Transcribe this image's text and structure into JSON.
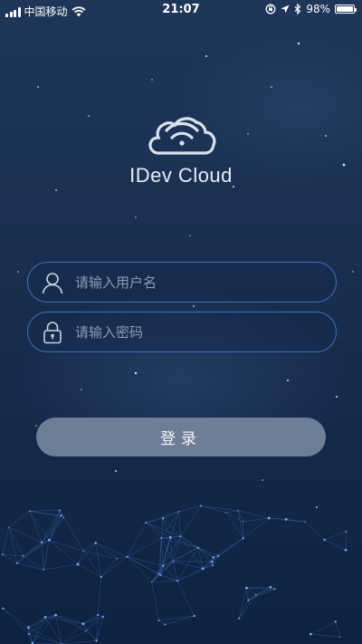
{
  "status_bar": {
    "carrier": "中国移动",
    "time": "21:07",
    "battery": "98%",
    "battery_level": 0.98,
    "icons": [
      "signal-icon",
      "wifi-icon",
      "orientation-lock-icon",
      "location-icon",
      "bluetooth-icon",
      "battery-icon"
    ]
  },
  "app": {
    "name": "IDev Cloud",
    "logo_icon": "cloud-wifi-icon"
  },
  "login_form": {
    "username": {
      "placeholder": "请输入用户名",
      "value": "",
      "icon": "user-icon"
    },
    "password": {
      "placeholder": "请输入密码",
      "value": "",
      "icon": "lock-icon"
    },
    "submit_label": "登录"
  },
  "colors": {
    "background": "#1a2f50",
    "field_border": "#3c6fb8",
    "button": "#6e7e97",
    "placeholder": "#8d9bb3"
  }
}
